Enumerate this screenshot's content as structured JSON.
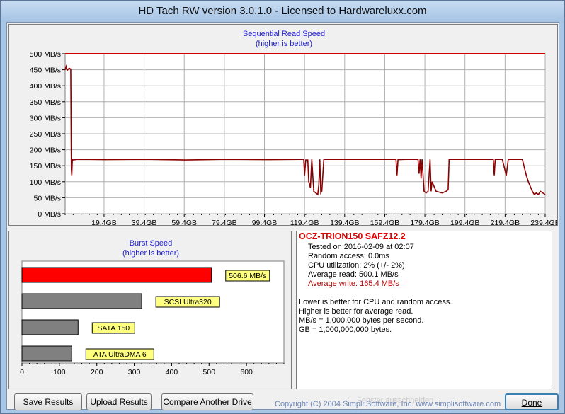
{
  "window": {
    "title": "HD Tach RW version 3.0.1.0 - Licensed to Hardwareluxx.com"
  },
  "sequential": {
    "title": "Sequential Read Speed",
    "subtitle": "(higher is better)"
  },
  "burst": {
    "title": "Burst Speed",
    "subtitle": "(higher is better)"
  },
  "info": {
    "drive": "OCZ-TRION150 SAFZ12.2",
    "tested": "Tested on 2016-02-09 at 02:07",
    "random_access": "Random access: 0.0ms",
    "cpu": "CPU utilization: 2% (+/- 2%)",
    "avg_read": "Average read: 500.1 MB/s",
    "avg_write": "Average write: 165.4 MB/s",
    "note1": "Lower is better for CPU and random access.",
    "note2": "Higher is better for average read.",
    "note3": "MB/s = 1,000,000 bytes per second.",
    "note4": "GB = 1,000,000,000 bytes.",
    "ghost": "Fenster ausschneiden"
  },
  "buttons": {
    "save": "Save Results",
    "upload": "Upload Results",
    "compare": "Compare Another Drive",
    "done": "Done"
  },
  "copyright": "Copyright (C) 2004 Simpli Software, Inc. www.simplisoftware.com",
  "colors": {
    "read": "#d00000",
    "write": "#8b0000",
    "burst": "#ff0000",
    "ref": "#808080",
    "label_bg": "#ffff80"
  },
  "chart_data": [
    {
      "type": "line",
      "title": "Sequential Read Speed",
      "subtitle": "(higher is better)",
      "ylim": [
        0,
        500
      ],
      "xlim": [
        0,
        239.4
      ],
      "y_ticks": [
        "0 MB/s",
        "50 MB/s",
        "100 MB/s",
        "150 MB/s",
        "200 MB/s",
        "250 MB/s",
        "300 MB/s",
        "350 MB/s",
        "400 MB/s",
        "450 MB/s",
        "500 MB/s"
      ],
      "y_tick_values": [
        0,
        50,
        100,
        150,
        200,
        250,
        300,
        350,
        400,
        450,
        500
      ],
      "x_ticks": [
        "19,4GB",
        "39,4GB",
        "59,4GB",
        "79,4GB",
        "99,4GB",
        "119,4GB",
        "139,4GB",
        "159,4GB",
        "179,4GB",
        "199,4GB",
        "219,4GB",
        "239,4GB"
      ],
      "x_tick_values": [
        19.4,
        39.4,
        59.4,
        79.4,
        99.4,
        119.4,
        139.4,
        159.4,
        179.4,
        199.4,
        219.4,
        239.4
      ],
      "grid": true,
      "series": [
        {
          "values_x": [
            0,
            239.4
          ],
          "values_y": [
            500,
            500
          ]
        },
        {
          "values_x": [
            0,
            0.5,
            1,
            2,
            2.8,
            3.1,
            3.3,
            3.6,
            4,
            6,
            20,
            40,
            60,
            80,
            100,
            118,
            119,
            119.4,
            120,
            121,
            121.5,
            122,
            122.3,
            123,
            124,
            125,
            126,
            126.5,
            127,
            127.5,
            128,
            129,
            140,
            160,
            165,
            165.5,
            166,
            166.5,
            170,
            175,
            176,
            176.5,
            177,
            177.5,
            178,
            179,
            180,
            181,
            181.5,
            182,
            182.5,
            183,
            185,
            188,
            190,
            191,
            191.5,
            192,
            192.5,
            195,
            197,
            200,
            202,
            205,
            210,
            213,
            213.5,
            214,
            214.5,
            216,
            218,
            220,
            221,
            222,
            224,
            226,
            227,
            228,
            230,
            231,
            232,
            233,
            234,
            235,
            236,
            237,
            239.4
          ],
          "values_y": [
            450,
            460,
            448,
            455,
            452,
            140,
            120,
            170,
            168,
            170,
            169,
            170,
            168,
            170,
            169,
            170,
            170,
            120,
            168,
            168,
            100,
            90,
            80,
            170,
            70,
            65,
            60,
            90,
            170,
            65,
            70,
            170,
            170,
            170,
            170,
            120,
            169,
            169,
            170,
            170,
            170,
            125,
            170,
            110,
            170,
            70,
            65,
            70,
            120,
            170,
            70,
            100,
            70,
            65,
            70,
            75,
            170,
            170,
            170,
            170,
            170,
            170,
            170,
            170,
            170,
            170,
            170,
            120,
            170,
            170,
            170,
            120,
            170,
            170,
            170,
            170,
            170,
            170,
            120,
            100,
            85,
            70,
            60,
            65,
            60,
            70,
            60,
            170,
            170
          ]
        }
      ]
    },
    {
      "type": "bar",
      "title": "Burst Speed",
      "subtitle": "(higher is better)",
      "xlim": [
        0,
        700
      ],
      "x_ticks": [
        0,
        100,
        200,
        300,
        400,
        500,
        600
      ],
      "categories": [
        "506.6 MB/s",
        "SCSI Ultra320",
        "SATA 150",
        "ATA UltraDMA 6"
      ],
      "values": [
        506.6,
        320,
        150,
        133
      ]
    }
  ]
}
